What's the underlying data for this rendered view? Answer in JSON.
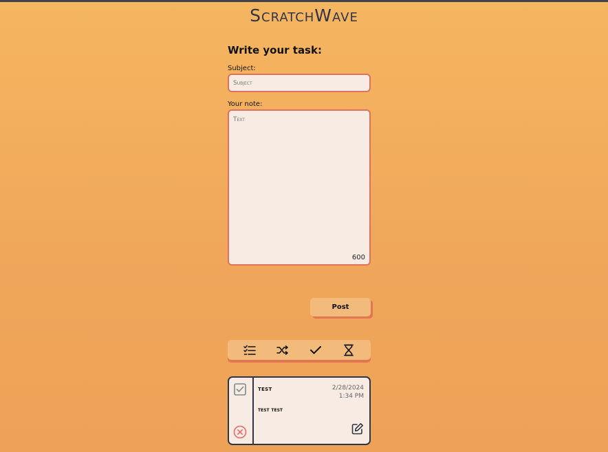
{
  "app": {
    "title": "ScratchWave"
  },
  "form": {
    "heading": "Write your task:",
    "subject_label": "Subject:",
    "subject_placeholder": "Subject",
    "subject_value": "",
    "note_label": "Your note:",
    "note_placeholder": "Text",
    "note_value": "",
    "char_count": "600",
    "post_label": "Post"
  },
  "filters": [
    {
      "icon": "list-check-icon"
    },
    {
      "icon": "shuffle-icon"
    },
    {
      "icon": "checkmark-icon"
    },
    {
      "icon": "hourglass-icon"
    }
  ],
  "tasks": [
    {
      "subject": "test",
      "date": "2/28/2024",
      "time": "1:34 PM",
      "text": "test test",
      "completed": false
    }
  ],
  "colors": {
    "background_top": "#f5b660",
    "background_bottom": "#eea257",
    "input_border": "#e0715e",
    "input_bg": "#f7ebe3",
    "button_bg": "#f2bb7c",
    "button_shadow": "#e2764f",
    "dark": "#2f3447",
    "delete_red": "#e36b6b",
    "check_gray": "#7b8a86"
  }
}
